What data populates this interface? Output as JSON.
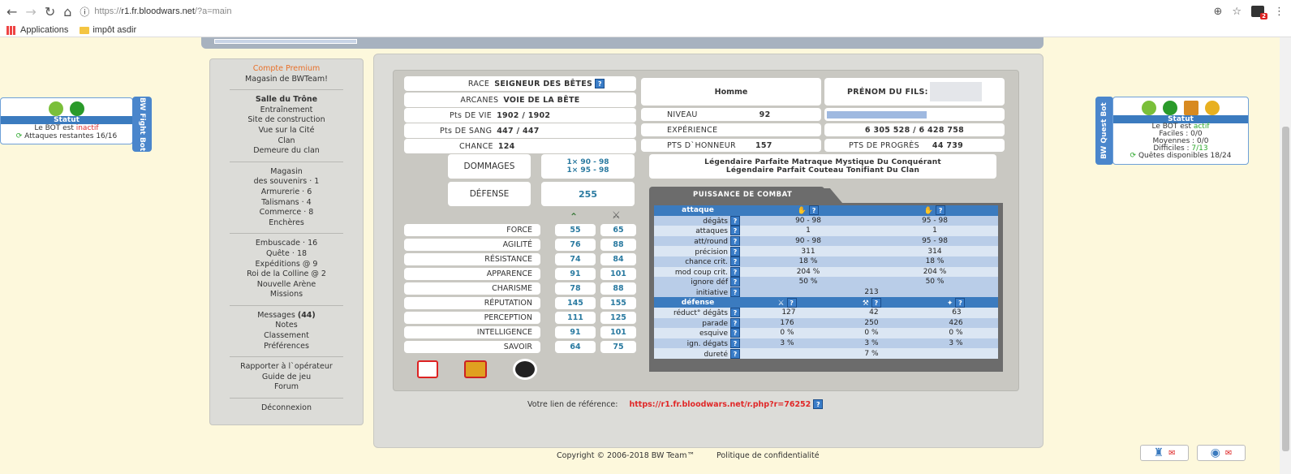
{
  "browser": {
    "url_prefix": "https://",
    "url_host": "r1.fr.bloodwars.net",
    "url_path": "/?a=main",
    "bookmarks": [
      "Applications",
      "impôt asdir"
    ],
    "ext_badge": "2"
  },
  "menu": {
    "group1": [
      "Compte Premium",
      "Magasin de BWTeam!"
    ],
    "group2_title": "Salle du Trône",
    "group2": [
      "Entraînement",
      "Site de construction",
      "Vue sur la Cité",
      "Clan",
      "Demeure du clan"
    ],
    "group3": [
      "Magasin",
      "des souvenirs · 1",
      "Armurerie · 6",
      "Talismans · 4",
      "Commerce · 8",
      "Enchères"
    ],
    "group4": [
      "Embuscade · 16",
      "Quête · 18",
      "Expéditions @ 9",
      "Roi de la Colline @ 2",
      "Nouvelle Arène",
      "Missions"
    ],
    "messages_label": "Messages",
    "messages_count": "(44)",
    "group5": [
      "Notes",
      "Classement",
      "Préférences"
    ],
    "group6": [
      "Rapporter à l`opérateur",
      "Guide de jeu",
      "Forum"
    ],
    "logout": "Déconnexion"
  },
  "profile": {
    "race_label": "RACE",
    "race": "SEIGNEUR DES BÊTES",
    "arcanes_label": "ARCANES",
    "arcanes": "VOIE DE LA BÊTE",
    "vie_label": "Pts DE VIE",
    "vie": "1902 / 1902",
    "sang_label": "Pts DE SANG",
    "sang": "447 / 447",
    "chance_label": "CHANCE",
    "chance": "124",
    "gender": "Homme",
    "son_label": "PRÉNOM DU FILS:",
    "niveau_label": "NIVEAU",
    "niveau": "92",
    "niveau_progress": 0.57,
    "exp_label": "EXPÉRIENCE",
    "exp": "6 305 528 / 6 428 758",
    "honneur_label": "PTS D`HONNEUR",
    "honneur": "157",
    "progres_label": "PTS DE PROGRÈS",
    "progres": "44 739",
    "dommages_label": "DOMMAGES",
    "dommages1": "1× 90 - 98",
    "dommages2": "1× 95 - 98",
    "defense_label": "DÉFENSE",
    "defense": "255",
    "weapon1": "Légendaire Parfaite Matraque Mystique Du Conquérant",
    "weapon2": "Légendaire Parfait Couteau Tonifiant Du Clan"
  },
  "stats": [
    {
      "name": "FORCE",
      "base": "55",
      "total": "65"
    },
    {
      "name": "AGILITÉ",
      "base": "76",
      "total": "88"
    },
    {
      "name": "RÉSISTANCE",
      "base": "74",
      "total": "84"
    },
    {
      "name": "APPARENCE",
      "base": "91",
      "total": "101"
    },
    {
      "name": "CHARISME",
      "base": "78",
      "total": "88"
    },
    {
      "name": "RÉPUTATION",
      "base": "145",
      "total": "155"
    },
    {
      "name": "PERCEPTION",
      "base": "111",
      "total": "125"
    },
    {
      "name": "INTELLIGENCE",
      "base": "91",
      "total": "101"
    },
    {
      "name": "SAVOIR",
      "base": "64",
      "total": "75"
    }
  ],
  "combat": {
    "tab": "PUISSANCE DE COMBAT",
    "attaque_hdr": "attaque",
    "defense_hdr": "défense",
    "attack_rows": [
      {
        "label": "dégâts",
        "c1": "90 - 98",
        "c2": "95 - 98"
      },
      {
        "label": "attaques",
        "c1": "1",
        "c2": "1"
      },
      {
        "label": "att/round",
        "c1": "90 - 98",
        "c2": "95 - 98"
      },
      {
        "label": "précision",
        "c1": "311",
        "c2": "314"
      },
      {
        "label": "chance crit.",
        "c1": "18 %",
        "c2": "18 %"
      },
      {
        "label": "mod coup crit.",
        "c1": "204 %",
        "c2": "204 %"
      },
      {
        "label": "ignore déf",
        "c1": "50 %",
        "c2": "50 %"
      }
    ],
    "initiative_label": "initiative",
    "initiative": "213",
    "def_rows": [
      {
        "label": "réduct° dégâts",
        "c1": "127",
        "c2": "42",
        "c3": "63"
      },
      {
        "label": "parade",
        "c1": "176",
        "c2": "250",
        "c3": "426"
      },
      {
        "label": "esquive",
        "c1": "0 %",
        "c2": "0 %",
        "c3": "0 %"
      },
      {
        "label": "ign. dégats",
        "c1": "3 %",
        "c2": "3 %",
        "c3": "3 %"
      }
    ],
    "durete_label": "dureté",
    "durete": "7 %"
  },
  "ref": {
    "label": "Votre lien de référence:",
    "url": "https://r1.fr.bloodwars.net/r.php?r=76252"
  },
  "footer": {
    "copyright": "Copyright © 2006-2018 BW Team™",
    "privacy": "Politique de confidentialité"
  },
  "fight_bot": {
    "tab": "BW Fight Bot",
    "status_hdr": "Statut",
    "line1_prefix": "Le BOT est ",
    "line1_state": "inactif",
    "line2": "Attaques restantes 16/16"
  },
  "quest_bot": {
    "tab": "BW Quest Bot",
    "status_hdr": "Statut",
    "line1_prefix": "Le BOT est ",
    "line1_state": "actif",
    "faciles": "Faciles : 0/0",
    "moyennes": "Moyennes : 0/0",
    "difficiles_prefix": "Difficiles : ",
    "difficiles_val": "7/13",
    "quetes": "Quêtes disponibles 18/24"
  },
  "qm": "?"
}
